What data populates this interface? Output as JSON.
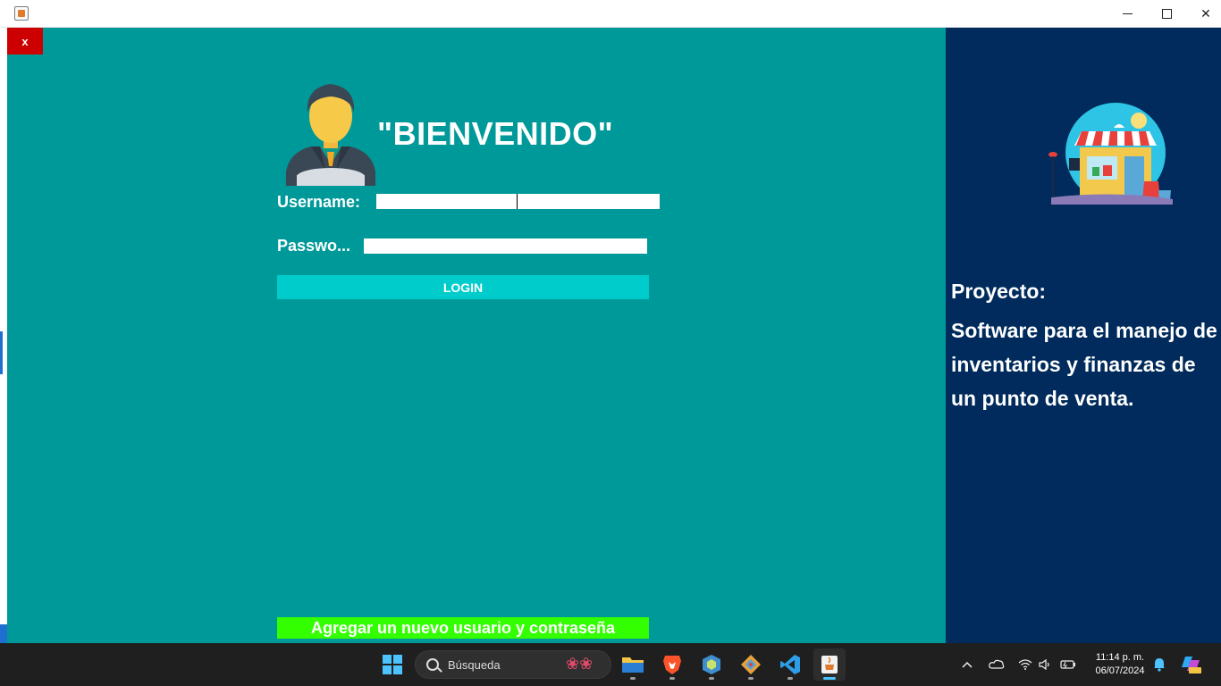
{
  "window": {
    "close_symbol": "✕",
    "minimize_icon": "minimize-icon",
    "maximize_icon": "maximize-icon"
  },
  "login": {
    "close_label": "x",
    "welcome": "\"BIENVENIDO\"",
    "username_label": "Username:",
    "password_label": "Passwo...",
    "username_value": "",
    "password_value": "",
    "login_button": "LOGIN",
    "add_user_button": "Agregar un nuevo usuario y contraseña"
  },
  "project": {
    "label": "Proyecto:",
    "description": "Software para el manejo de inventarios y finanzas de un punto de venta."
  },
  "taskbar": {
    "search_placeholder": "Búsqueda",
    "time": "11:14 p. m.",
    "date": "06/07/2024"
  },
  "colors": {
    "left_panel": "#009999",
    "right_panel": "#002b5c",
    "login_button": "#00cccc",
    "add_button": "#33ff00",
    "close_button": "#cc0000"
  }
}
